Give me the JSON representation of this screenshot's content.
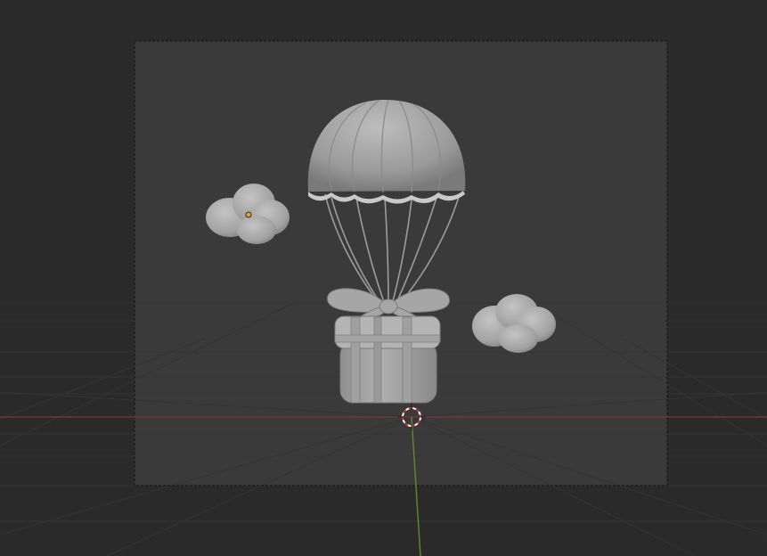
{
  "app": {
    "name": "3D Viewport"
  },
  "scene": {
    "objects": [
      {
        "name": "parachute-canopy",
        "kind": "mesh"
      },
      {
        "name": "parachute-strings",
        "kind": "mesh"
      },
      {
        "name": "gift-box",
        "kind": "mesh"
      },
      {
        "name": "gift-bow",
        "kind": "mesh"
      },
      {
        "name": "cloud-left",
        "kind": "mesh",
        "selected_origin": true
      },
      {
        "name": "cloud-right",
        "kind": "mesh"
      }
    ],
    "colors": {
      "background": "#2a2a2a",
      "camera_frame_fill": "#3a3a3a",
      "grid_line": "#353535",
      "x_axis": "#8a3a44",
      "y_axis": "#5f8a2e",
      "mesh": "#a8a8a8",
      "origin_dot": "#f0a030",
      "cursor_red": "#cc3333",
      "cursor_white": "#ffffff"
    }
  }
}
